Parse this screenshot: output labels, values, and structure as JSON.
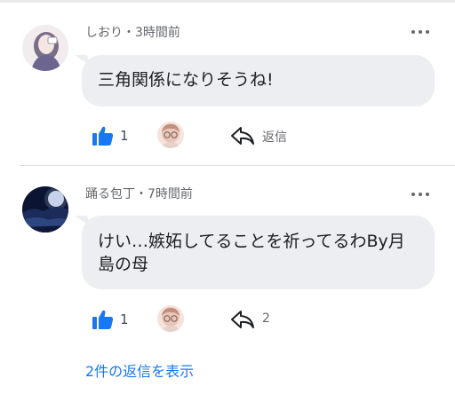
{
  "comments": [
    {
      "author": "しおり・3時間前",
      "text": "三角関係になりそうね!",
      "likes": "1",
      "reply_label": "返信"
    },
    {
      "author": "踊る包丁・7時間前",
      "text": "けい…嫉妬してることを祈ってるわBy月島の母",
      "likes": "1",
      "reply_label": "2"
    }
  ],
  "show_replies": "2件の返信を表示",
  "colors": {
    "accent": "#1877f2",
    "bubble": "#eceef1",
    "meta": "#65676b"
  },
  "icons": [
    "like-thumb-icon",
    "reply-arrow-icon",
    "more-options-icon"
  ]
}
